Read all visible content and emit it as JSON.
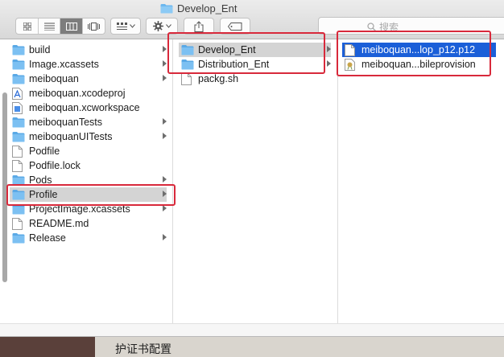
{
  "window": {
    "title": "Develop_Ent"
  },
  "toolbar": {
    "view_buttons": [
      "icon-view-icon",
      "list-view-icon",
      "column-view-icon",
      "cover-flow-icon"
    ],
    "arrange_icon": "arrange-icon",
    "action_icon": "gear-icon",
    "share_icon": "share-icon",
    "tags_icon": "tag-icon"
  },
  "search": {
    "placeholder": "搜索"
  },
  "columns": {
    "col1": [
      {
        "label": "build",
        "icon": "folder",
        "chevron": true
      },
      {
        "label": "Image.xcassets",
        "icon": "folder",
        "chevron": true
      },
      {
        "label": "meiboquan",
        "icon": "folder",
        "chevron": true
      },
      {
        "label": "meiboquan.xcodeproj",
        "icon": "xcodeproj",
        "chevron": false
      },
      {
        "label": "meiboquan.xcworkspace",
        "icon": "xcworkspace",
        "chevron": false
      },
      {
        "label": "meiboquanTests",
        "icon": "folder",
        "chevron": true
      },
      {
        "label": "meiboquanUITests",
        "icon": "folder",
        "chevron": true
      },
      {
        "label": "Podfile",
        "icon": "document",
        "chevron": false
      },
      {
        "label": "Podfile.lock",
        "icon": "document",
        "chevron": false
      },
      {
        "label": "Pods",
        "icon": "folder",
        "chevron": true
      },
      {
        "label": "Profile",
        "icon": "folder",
        "chevron": true,
        "selected": "gray"
      },
      {
        "label": "ProjectImage.xcassets",
        "icon": "folder",
        "chevron": true
      },
      {
        "label": "README.md",
        "icon": "document",
        "chevron": false
      },
      {
        "label": "Release",
        "icon": "folder",
        "chevron": true
      }
    ],
    "col2": [
      {
        "label": "Develop_Ent",
        "icon": "folder",
        "chevron": true,
        "selected": "gray"
      },
      {
        "label": "Distribution_Ent",
        "icon": "folder",
        "chevron": true
      },
      {
        "label": "packg.sh",
        "icon": "document",
        "chevron": false
      }
    ],
    "col3": [
      {
        "label": "meiboquan...lop_p12.p12",
        "icon": "document",
        "chevron": false,
        "selected": "blue"
      },
      {
        "label": "meiboquan...bileprovision",
        "icon": "certificate",
        "chevron": false
      }
    ]
  },
  "underlay": {
    "text": "护证书配置"
  },
  "colors": {
    "folder": "#6cb7ee",
    "selection_blue": "#1b5fd8",
    "selection_gray": "#d4d4d4",
    "highlight": "#d8293b"
  }
}
